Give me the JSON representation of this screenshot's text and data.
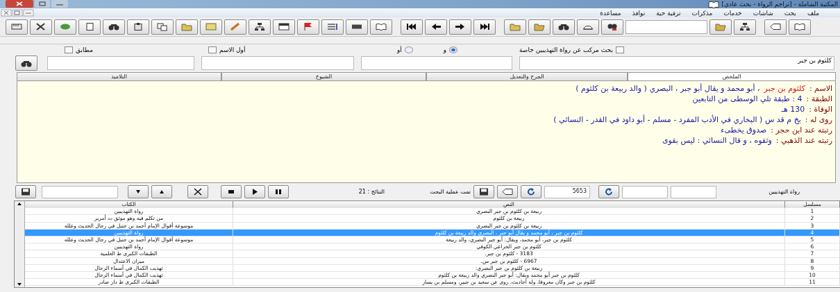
{
  "window": {
    "title": "المكتبة الشاملة - [تراجم الرواة - بحث عادي]"
  },
  "menu": [
    "ملف",
    "بحث",
    "شاشات",
    "خدمات",
    "مذكرات",
    "ترقية حية",
    "نوافذ",
    "مساعدة"
  ],
  "search": {
    "compound": {
      "label": "بحث مركب عن رواة التهذيبين خاصة",
      "checked": false
    },
    "operators": [
      {
        "label": "و",
        "selected": true
      },
      {
        "label": "أو",
        "selected": false
      }
    ],
    "options": [
      {
        "label": "أول الاسم",
        "checked": false
      },
      {
        "label": "مطابق",
        "checked": false
      }
    ],
    "query": "كلثوم بن جبر"
  },
  "tabs": [
    {
      "label": "الملخص",
      "selected": true
    },
    {
      "label": "الجرح والتعديل",
      "selected": false
    },
    {
      "label": "الشيوخ",
      "selected": false
    },
    {
      "label": "التلاميذ",
      "selected": false
    }
  ],
  "summary": [
    {
      "label": "الاسم :",
      "name": "كلثوم بن جبر",
      "value": "، أبو محمد و يقال أبو جبر ، البصري ( والد ربيعة بن كلثوم )"
    },
    {
      "label": "الطبقة :",
      "value": "4 : طبقة تلي الوسطى من التابعين"
    },
    {
      "label": "الوفاة :",
      "value": "130 هـ"
    },
    {
      "label": "روى له :",
      "value": "بخ م قد س ( البخاري في الأدب المفرد - مسلم - أبو داود في القدر - النسائي )"
    },
    {
      "label": "رتبته عند ابن حجر :",
      "value": "صدوق يخطىء"
    },
    {
      "label": "رتبته عند الذهبي :",
      "value": "وثقوه ، و قال النسائي : ليس بقوى"
    }
  ],
  "results_bar": {
    "label": "رواة التهذيبين",
    "total": "5653",
    "status": "تمت عملية البحث",
    "count": "النتائج : 21"
  },
  "table": {
    "columns": [
      "مسلسل",
      "النص",
      "الكتاب"
    ],
    "rows": [
      {
        "cells": [
          "1",
          "ربيعة بن كلثوم بن جبر البصري",
          "رواة التهذيبين"
        ],
        "selected": false
      },
      {
        "cells": [
          "2",
          "ربيعة بن كلثوم",
          "من تكلم فيه وهو موثق ت أمرير"
        ],
        "selected": false
      },
      {
        "cells": [
          "3",
          "ربيعة بن كلثوم بن جبر البصري",
          "موسوعة أقوال الإمام أحمد بن حنبل في رجال الحديث وعلله"
        ],
        "selected": false
      },
      {
        "cells": [
          "4",
          "كلثوم بن جبر ، أبو محمد و يقال أبو جبر ، البصري والد ربيعة بن كلثوم",
          "رواة التهذيبين"
        ],
        "selected": true
      },
      {
        "cells": [
          "5",
          "كلثوم بن جبر، أبو محمد، ويقال: أبو جبر البصري، والد ربيعة",
          "موسوعة أقوال الإمام أحمد بن حنبل في رجال الحديث وعلله"
        ],
        "selected": false
      },
      {
        "cells": [
          "6",
          "كلثوم بن جبر الخزاعي الكوفي",
          "رواة التهذيبين"
        ],
        "selected": false
      },
      {
        "cells": [
          "7",
          "3183 - كلثوم بن جبر.",
          "الطبقات الكبرى ط العلمية"
        ],
        "selected": false
      },
      {
        "cells": [
          "8",
          "6967 - كلثوم بن جبر س.",
          "ميزان الاعتدال"
        ],
        "selected": false
      },
      {
        "cells": [
          "9",
          "ربيعة بن كلثوم بن جبر البصري:",
          "تهذيب الكمال في أسماء الرجال"
        ],
        "selected": false
      },
      {
        "cells": [
          "10",
          "كلثوم بن جبر أبو محمد ويقال: أبو جبر البصري والد ربيعة بن كلثوم",
          "تهذيب الكمال في أسماء الرجال"
        ],
        "selected": false
      },
      {
        "cells": [
          "11",
          "كلثوم بن جبر وكان معروفا، وله أحاديث، روى عن سعيد بن جبير، ومسلم بن يسار",
          "الطبقات الكبرى ط دار صادر"
        ],
        "selected": false
      }
    ]
  }
}
